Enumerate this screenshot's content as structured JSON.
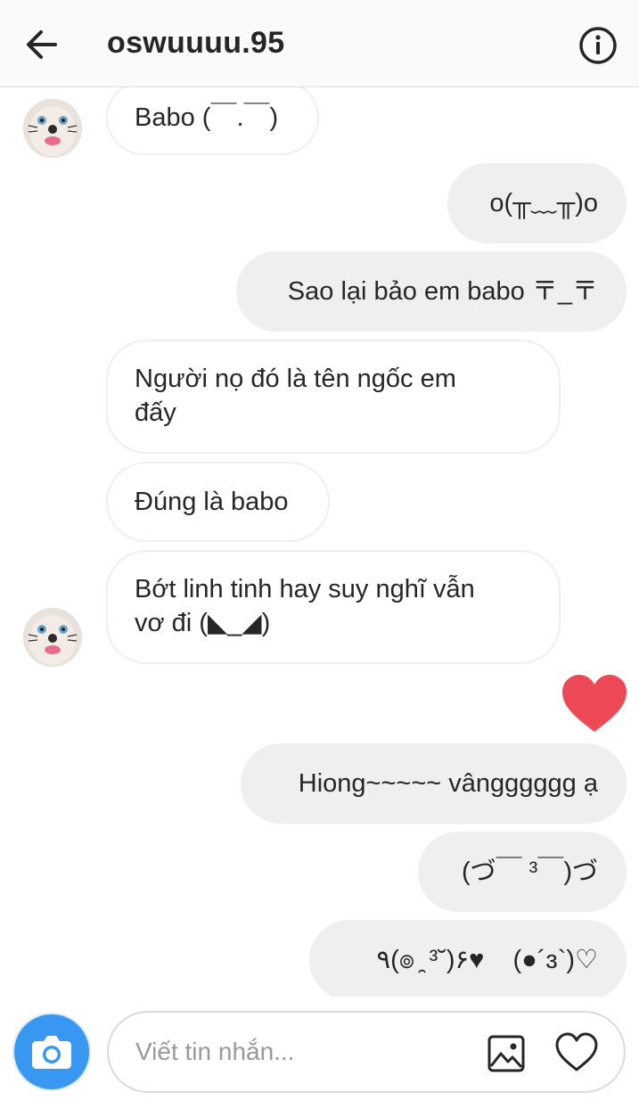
{
  "header": {
    "username": "oswuuuu.95",
    "back_icon": "arrow-left-icon",
    "info_icon": "info-circle-icon"
  },
  "messages": [
    {
      "direction": "in",
      "text": "Babo (￣.￣)"
    },
    {
      "direction": "out",
      "text": "o(╥﹏╥)o"
    },
    {
      "direction": "out",
      "text": "Sao lại bảo em babo 〒_〒"
    },
    {
      "direction": "in",
      "line1": "Người nọ đó là tên ngốc em",
      "line2": "đấy"
    },
    {
      "direction": "in",
      "text": "Đúng là babo"
    },
    {
      "direction": "in",
      "line1": "Bớt linh tinh hay suy nghĩ vẫn",
      "line2": "vơ đi (◣_◢)"
    },
    {
      "direction": "out",
      "text": "Hiong~~~~~ vângggggg ạ"
    },
    {
      "direction": "out",
      "text": "(づ￣ ³￣)づ"
    },
    {
      "direction": "out",
      "text": "٩(๏ ̯ ³˘)۶♥    (●´ɜ`)♡"
    }
  ],
  "reaction": {
    "icon": "heart-filled-icon",
    "color": "#ed4956"
  },
  "composer": {
    "placeholder": "Viết tin nhắn...",
    "camera_icon": "camera-icon",
    "gallery_icon": "gallery-icon",
    "like_icon": "heart-outline-icon",
    "accent": "#3897f0"
  }
}
